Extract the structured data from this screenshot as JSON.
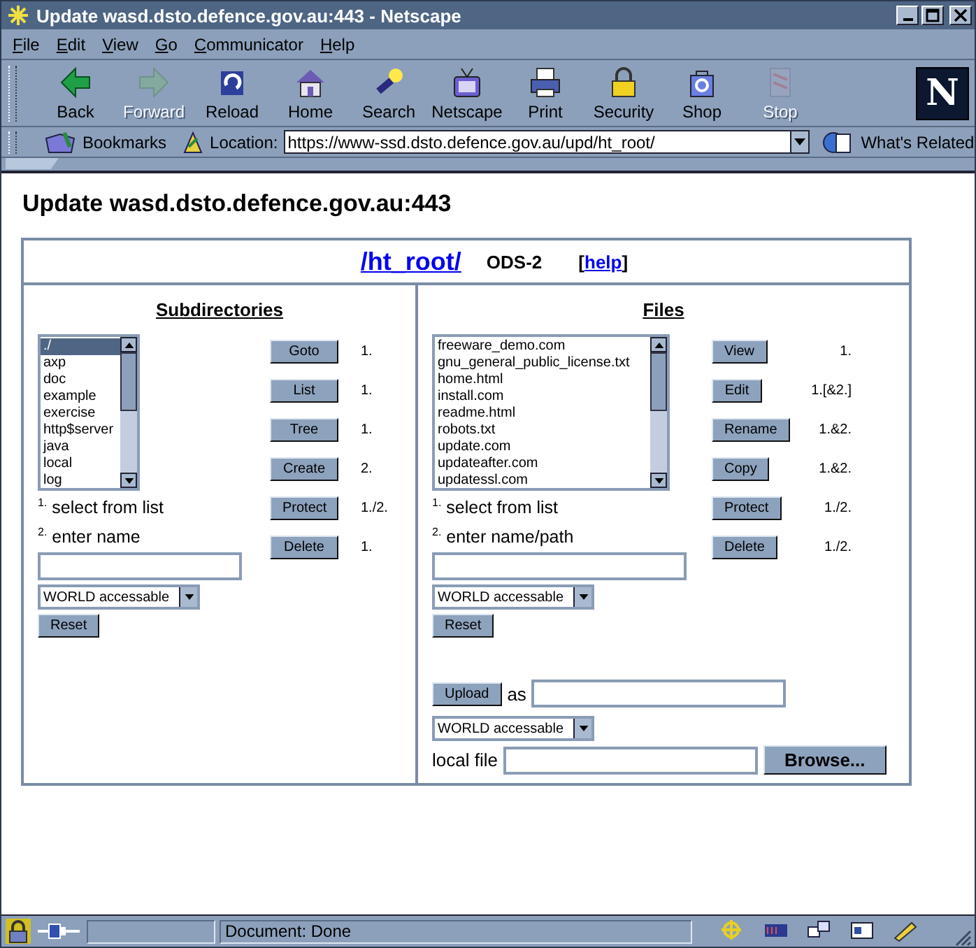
{
  "window": {
    "title": "Update wasd.dsto.defence.gov.au:443 - Netscape"
  },
  "menu": [
    {
      "label": "File"
    },
    {
      "label": "Edit"
    },
    {
      "label": "View"
    },
    {
      "label": "Go"
    },
    {
      "label": "Communicator"
    },
    {
      "label": "Help"
    }
  ],
  "toolbar": [
    {
      "label": "Back",
      "disabled": false
    },
    {
      "label": "Forward",
      "disabled": true
    },
    {
      "label": "Reload",
      "disabled": false
    },
    {
      "label": "Home",
      "disabled": false
    },
    {
      "label": "Search",
      "disabled": false
    },
    {
      "label": "Netscape",
      "disabled": false
    },
    {
      "label": "Print",
      "disabled": false
    },
    {
      "label": "Security",
      "disabled": false
    },
    {
      "label": "Shop",
      "disabled": false
    },
    {
      "label": "Stop",
      "disabled": true
    }
  ],
  "logo": "N",
  "location_bar": {
    "bookmarks": "Bookmarks",
    "location_label": "Location:",
    "url": "https://www-ssd.dsto.defence.gov.au/upd/ht_root/",
    "whats_related": "What's Related"
  },
  "page": {
    "heading": "Update wasd.dsto.defence.gov.au:443",
    "path_link": "/ht_root/",
    "filesystem": "ODS-2",
    "help": {
      "open": "[",
      "link": "help",
      "close": "]"
    },
    "panels": [
      {
        "title": "Subdirectories",
        "list": [
          {
            "label": "./",
            "selected": true
          },
          {
            "label": "axp",
            "selected": false
          },
          {
            "label": "doc",
            "selected": false
          },
          {
            "label": "example",
            "selected": false
          },
          {
            "label": "exercise",
            "selected": false
          },
          {
            "label": "http$server",
            "selected": false
          },
          {
            "label": "java",
            "selected": false
          },
          {
            "label": "local",
            "selected": false
          },
          {
            "label": "log",
            "selected": false
          }
        ],
        "steps": [
          "$^{1.}$ select from list",
          "$^{2.}$ enter name"
        ],
        "protection": "WORLD accessable",
        "reset": "Reset",
        "actions": [
          {
            "label": "Goto",
            "note": "1."
          },
          {
            "label": "List",
            "note": "1."
          },
          {
            "label": "Tree",
            "note": "1."
          },
          {
            "label": "Create",
            "note": "2."
          },
          {
            "label": "Protect",
            "note": "1./2."
          },
          {
            "label": "Delete",
            "note": "1."
          }
        ]
      },
      {
        "title": "Files",
        "list": [
          {
            "label": "freeware_demo.com",
            "selected": false
          },
          {
            "label": "gnu_general_public_license.txt",
            "selected": false
          },
          {
            "label": "home.html",
            "selected": false
          },
          {
            "label": "install.com",
            "selected": false
          },
          {
            "label": "readme.html",
            "selected": false
          },
          {
            "label": "robots.txt",
            "selected": false
          },
          {
            "label": "update.com",
            "selected": false
          },
          {
            "label": "updateafter.com",
            "selected": false
          },
          {
            "label": "updatessl.com",
            "selected": false
          }
        ],
        "steps": [
          "$^{1.}$ select from list",
          "$^{2.}$ enter name/path"
        ],
        "protection": "WORLD accessable",
        "reset": "Reset",
        "actions": [
          {
            "label": "View",
            "note": "1."
          },
          {
            "label": "Edit",
            "note": "1.[&2.]"
          },
          {
            "label": "Rename",
            "note": "1.&2."
          },
          {
            "label": "Copy",
            "note": "1.&2."
          },
          {
            "label": "Protect",
            "note": "1./2."
          },
          {
            "label": "Delete",
            "note": "1./2."
          }
        ],
        "upload": {
          "button": "Upload",
          "as": "as",
          "protection": "WORLD accessable",
          "local_file": "local file",
          "browse": "Browse..."
        }
      }
    ]
  },
  "status_bar": {
    "text": "Document: Done"
  }
}
